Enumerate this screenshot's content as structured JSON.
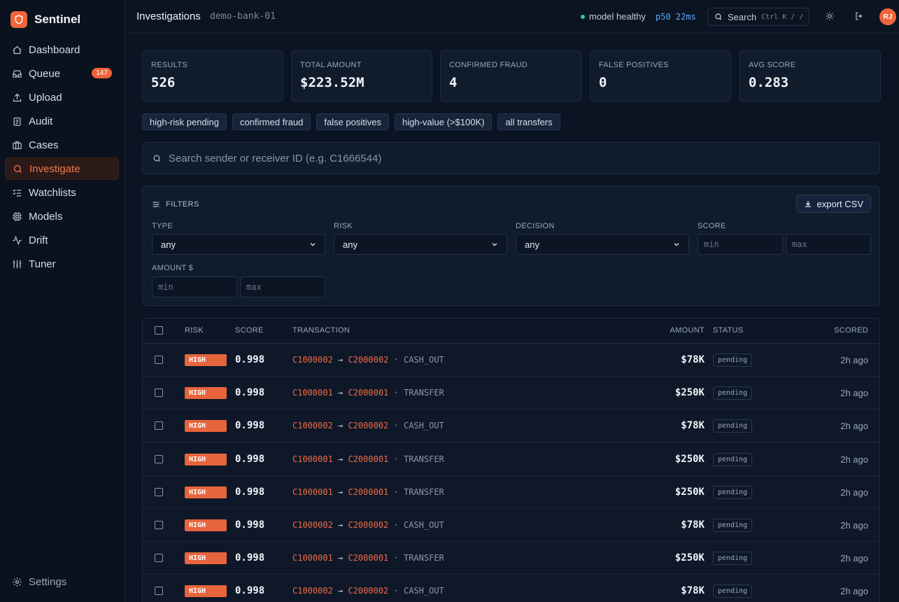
{
  "brand": {
    "name": "Sentinel"
  },
  "sidebar": {
    "items": [
      {
        "label": "Dashboard",
        "icon": "grid-icon"
      },
      {
        "label": "Queue",
        "icon": "inbox-icon",
        "badge": "147"
      },
      {
        "label": "Upload",
        "icon": "upload-icon"
      },
      {
        "label": "Audit",
        "icon": "clipboard-icon"
      },
      {
        "label": "Cases",
        "icon": "briefcase-icon"
      },
      {
        "label": "Investigate",
        "icon": "search-icon",
        "active": true
      },
      {
        "label": "Watchlists",
        "icon": "list-check-icon"
      },
      {
        "label": "Models",
        "icon": "cpu-icon"
      },
      {
        "label": "Drift",
        "icon": "activity-icon"
      },
      {
        "label": "Tuner",
        "icon": "sliders-icon"
      }
    ],
    "settings_label": "Settings"
  },
  "topbar": {
    "title": "Investigations",
    "workspace": "demo-bank-01",
    "status": "model healthy",
    "latency": "p50 22ms",
    "search_label": "Search",
    "search_kbd": "Ctrl K / /",
    "avatar": "RJ"
  },
  "stats": [
    {
      "label": "RESULTS",
      "value": "526"
    },
    {
      "label": "TOTAL AMOUNT",
      "value": "$223.52M"
    },
    {
      "label": "CONFIRMED FRAUD",
      "value": "4"
    },
    {
      "label": "FALSE POSITIVES",
      "value": "0"
    },
    {
      "label": "AVG SCORE",
      "value": "0.283"
    }
  ],
  "chips": [
    "high-risk pending",
    "confirmed fraud",
    "false positives",
    "high-value (>$100K)",
    "all transfers"
  ],
  "search": {
    "placeholder": "Search sender or receiver ID (e.g. C1666544)"
  },
  "filters": {
    "title": "FILTERS",
    "export_label": "export CSV",
    "type_label": "TYPE",
    "type_value": "any",
    "risk_label": "RISK",
    "risk_value": "any",
    "decision_label": "DECISION",
    "decision_value": "any",
    "score_label": "SCORE",
    "score_min": "min",
    "score_max": "max",
    "amount_label": "AMOUNT $",
    "amount_min": "min",
    "amount_max": "max"
  },
  "table": {
    "headers": {
      "risk": "RISK",
      "score": "SCORE",
      "transaction": "TRANSACTION",
      "amount": "AMOUNT",
      "status": "STATUS",
      "scored": "SCORED"
    },
    "rows": [
      {
        "risk": "HIGH",
        "score": "0.998",
        "sender": "C1000002",
        "receiver": "C2000002",
        "type": "CASH_OUT",
        "amount": "$78K",
        "status": "pending",
        "scored": "2h ago"
      },
      {
        "risk": "HIGH",
        "score": "0.998",
        "sender": "C1000001",
        "receiver": "C2000001",
        "type": "TRANSFER",
        "amount": "$250K",
        "status": "pending",
        "scored": "2h ago"
      },
      {
        "risk": "HIGH",
        "score": "0.998",
        "sender": "C1000002",
        "receiver": "C2000002",
        "type": "CASH_OUT",
        "amount": "$78K",
        "status": "pending",
        "scored": "2h ago"
      },
      {
        "risk": "HIGH",
        "score": "0.998",
        "sender": "C1000001",
        "receiver": "C2000001",
        "type": "TRANSFER",
        "amount": "$250K",
        "status": "pending",
        "scored": "2h ago"
      },
      {
        "risk": "HIGH",
        "score": "0.998",
        "sender": "C1000001",
        "receiver": "C2000001",
        "type": "TRANSFER",
        "amount": "$250K",
        "status": "pending",
        "scored": "2h ago"
      },
      {
        "risk": "HIGH",
        "score": "0.998",
        "sender": "C1000002",
        "receiver": "C2000002",
        "type": "CASH_OUT",
        "amount": "$78K",
        "status": "pending",
        "scored": "2h ago"
      },
      {
        "risk": "HIGH",
        "score": "0.998",
        "sender": "C1000001",
        "receiver": "C2000001",
        "type": "TRANSFER",
        "amount": "$250K",
        "status": "pending",
        "scored": "2h ago"
      },
      {
        "risk": "HIGH",
        "score": "0.998",
        "sender": "C1000002",
        "receiver": "C2000002",
        "type": "CASH_OUT",
        "amount": "$78K",
        "status": "pending",
        "scored": "2h ago"
      }
    ]
  },
  "colors": {
    "accent": "#f0643a",
    "background": "#0b1422",
    "healthy": "#3bc494",
    "latency": "#5fa8ff"
  }
}
